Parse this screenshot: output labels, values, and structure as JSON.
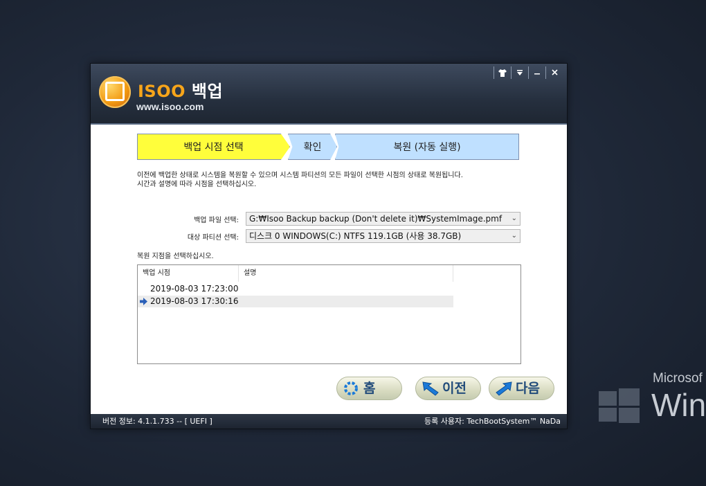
{
  "desktop": {
    "ms_text": "Microsof",
    "win_text": "Win"
  },
  "window": {
    "brand_latin": "ISOO",
    "brand_korean": "백업",
    "url": "www.isoo.com",
    "titlebar_buttons": [
      "shirt-icon",
      "dropdown-icon",
      "minimize-icon",
      "close-icon"
    ]
  },
  "steps": [
    {
      "label": "백업 시점 선택",
      "active": true
    },
    {
      "label": "확인",
      "active": false
    },
    {
      "label": "복원 (자동 실행)",
      "active": false
    }
  ],
  "description": {
    "line1": "이전에 백업한 상태로 시스템을 복원할 수 있으며 시스템 파티션의 모든 파일이 선택한 시점의 상태로 복원됩니다.",
    "line2": "시간과 설명에 따라 시점을 선택하십시오."
  },
  "form": {
    "backup_file_label": "백업 파일 선택:",
    "backup_file_value": "G:₩Isoo Backup backup (Don't delete it)₩SystemImage.pmf",
    "partition_label": "대상 파티션 선택:",
    "partition_value": "디스크 0  WINDOWS(C:) NTFS 119.1GB (사용 38.7GB)",
    "restore_point_label": "복원 지점을 선택하십시오."
  },
  "list": {
    "columns": [
      "백업 시점",
      "설명"
    ],
    "rows": [
      {
        "time": "2019-08-03 17:23:00",
        "desc": "",
        "selected": false
      },
      {
        "time": "2019-08-03 17:30:16",
        "desc": "",
        "selected": true
      }
    ]
  },
  "buttons": {
    "home": "홈",
    "prev": "이전",
    "next": "다음"
  },
  "status": {
    "version": "버전 정보: 4.1.1.733 -- [ UEFI ]",
    "registered": "등록 사용자: TechBootSystem™ NaDa"
  },
  "colors": {
    "active_step": "#fffe3b",
    "inactive_step": "#bfe0ff",
    "brand_orange": "#f7a51a"
  }
}
